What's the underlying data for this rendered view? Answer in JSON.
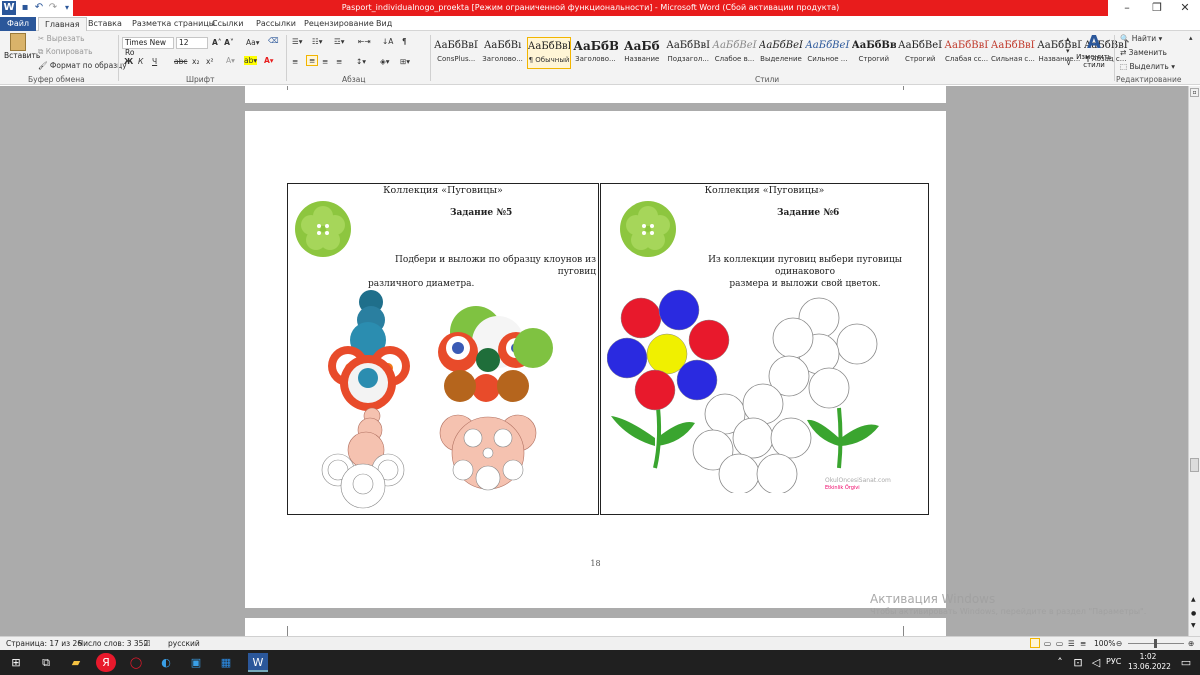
{
  "window": {
    "title": "Pasport_individualnogo_proekta [Режим ограниченной функциональности] - Microsoft Word (Сбой активации продукта)",
    "minimize": "–",
    "restore": "❐",
    "close": "✕"
  },
  "tabs": [
    "Файл",
    "Главная",
    "Вставка",
    "Разметка страницы",
    "Ссылки",
    "Рассылки",
    "Рецензирование",
    "Вид"
  ],
  "clipboard": {
    "paste": "Вставить",
    "cut": "Вырезать",
    "copy": "Копировать",
    "format_painter": "Формат по образцу",
    "label": "Буфер обмена"
  },
  "font": {
    "name": "Times New Ro",
    "size": "12",
    "label": "Шрифт"
  },
  "paragraph": {
    "label": "Абзац"
  },
  "styles": {
    "label": "Стили",
    "items": [
      {
        "sample": "АаБбВвГг",
        "name": "ConsPlus..."
      },
      {
        "sample": "АаБбВı",
        "name": "Заголово..."
      },
      {
        "sample": "АаБбВвГ",
        "name": "¶ Обычный"
      },
      {
        "sample": "АаБбВ",
        "name": "Заголово..."
      },
      {
        "sample": "АаБб",
        "name": "Название"
      },
      {
        "sample": "АаБбВвI",
        "name": "Подзагол..."
      },
      {
        "sample": "АаБбВеГ",
        "name": "Слабое в..."
      },
      {
        "sample": "АаБбВеГ",
        "name": "Выделение"
      },
      {
        "sample": "АаБбВеГ",
        "name": "Сильное ..."
      },
      {
        "sample": "АаБбВвГ",
        "name": "Строгий"
      },
      {
        "sample": "АаБбВеГ",
        "name": "Строгий"
      },
      {
        "sample": "АаБбВвГг",
        "name": "Слабая сс..."
      },
      {
        "sample": "АаБбВвГі",
        "name": "Сильная с..."
      },
      {
        "sample": "АаБбВвГі",
        "name": "Название..."
      },
      {
        "sample": "АаБбВвІ",
        "name": "¶ Абзац с..."
      }
    ],
    "change_styles": "Изменить стили"
  },
  "editing": {
    "find": "Найти",
    "replace": "Заменить",
    "select": "Выделить",
    "label": "Редактирование"
  },
  "document": {
    "cell1": {
      "title": "Коллекция «Пуговицы»",
      "task": "Задание №5",
      "desc_line1": "Подбери и выложи по образцу клоунов из пуговиц",
      "desc_line2": "различного диаметра."
    },
    "cell2": {
      "title": "Коллекция «Пуговицы»",
      "task": "Задание №6",
      "desc_line1": "Из коллекции пуговиц выбери пуговицы одинакового",
      "desc_line2": "размера и выложи свой цветок."
    },
    "page_number": "18",
    "image_caption": "OkulOncesiSanat.com",
    "image_caption2": "Etkinlik Örgivi"
  },
  "watermark": {
    "title": "Активация Windows",
    "subtitle": "Чтобы активировать Windows, перейдите в раздел \"Параметры\"."
  },
  "status": {
    "page": "Страница: 17 из 26",
    "words": "Число слов: 3 352",
    "lang": "русский",
    "zoom": "100%"
  },
  "taskbar": {
    "lang": "РУС",
    "time": "1:02",
    "date": "13.06.2022"
  },
  "colors": {
    "accent": "#2b579a",
    "red_bar": "#e81c1c"
  }
}
